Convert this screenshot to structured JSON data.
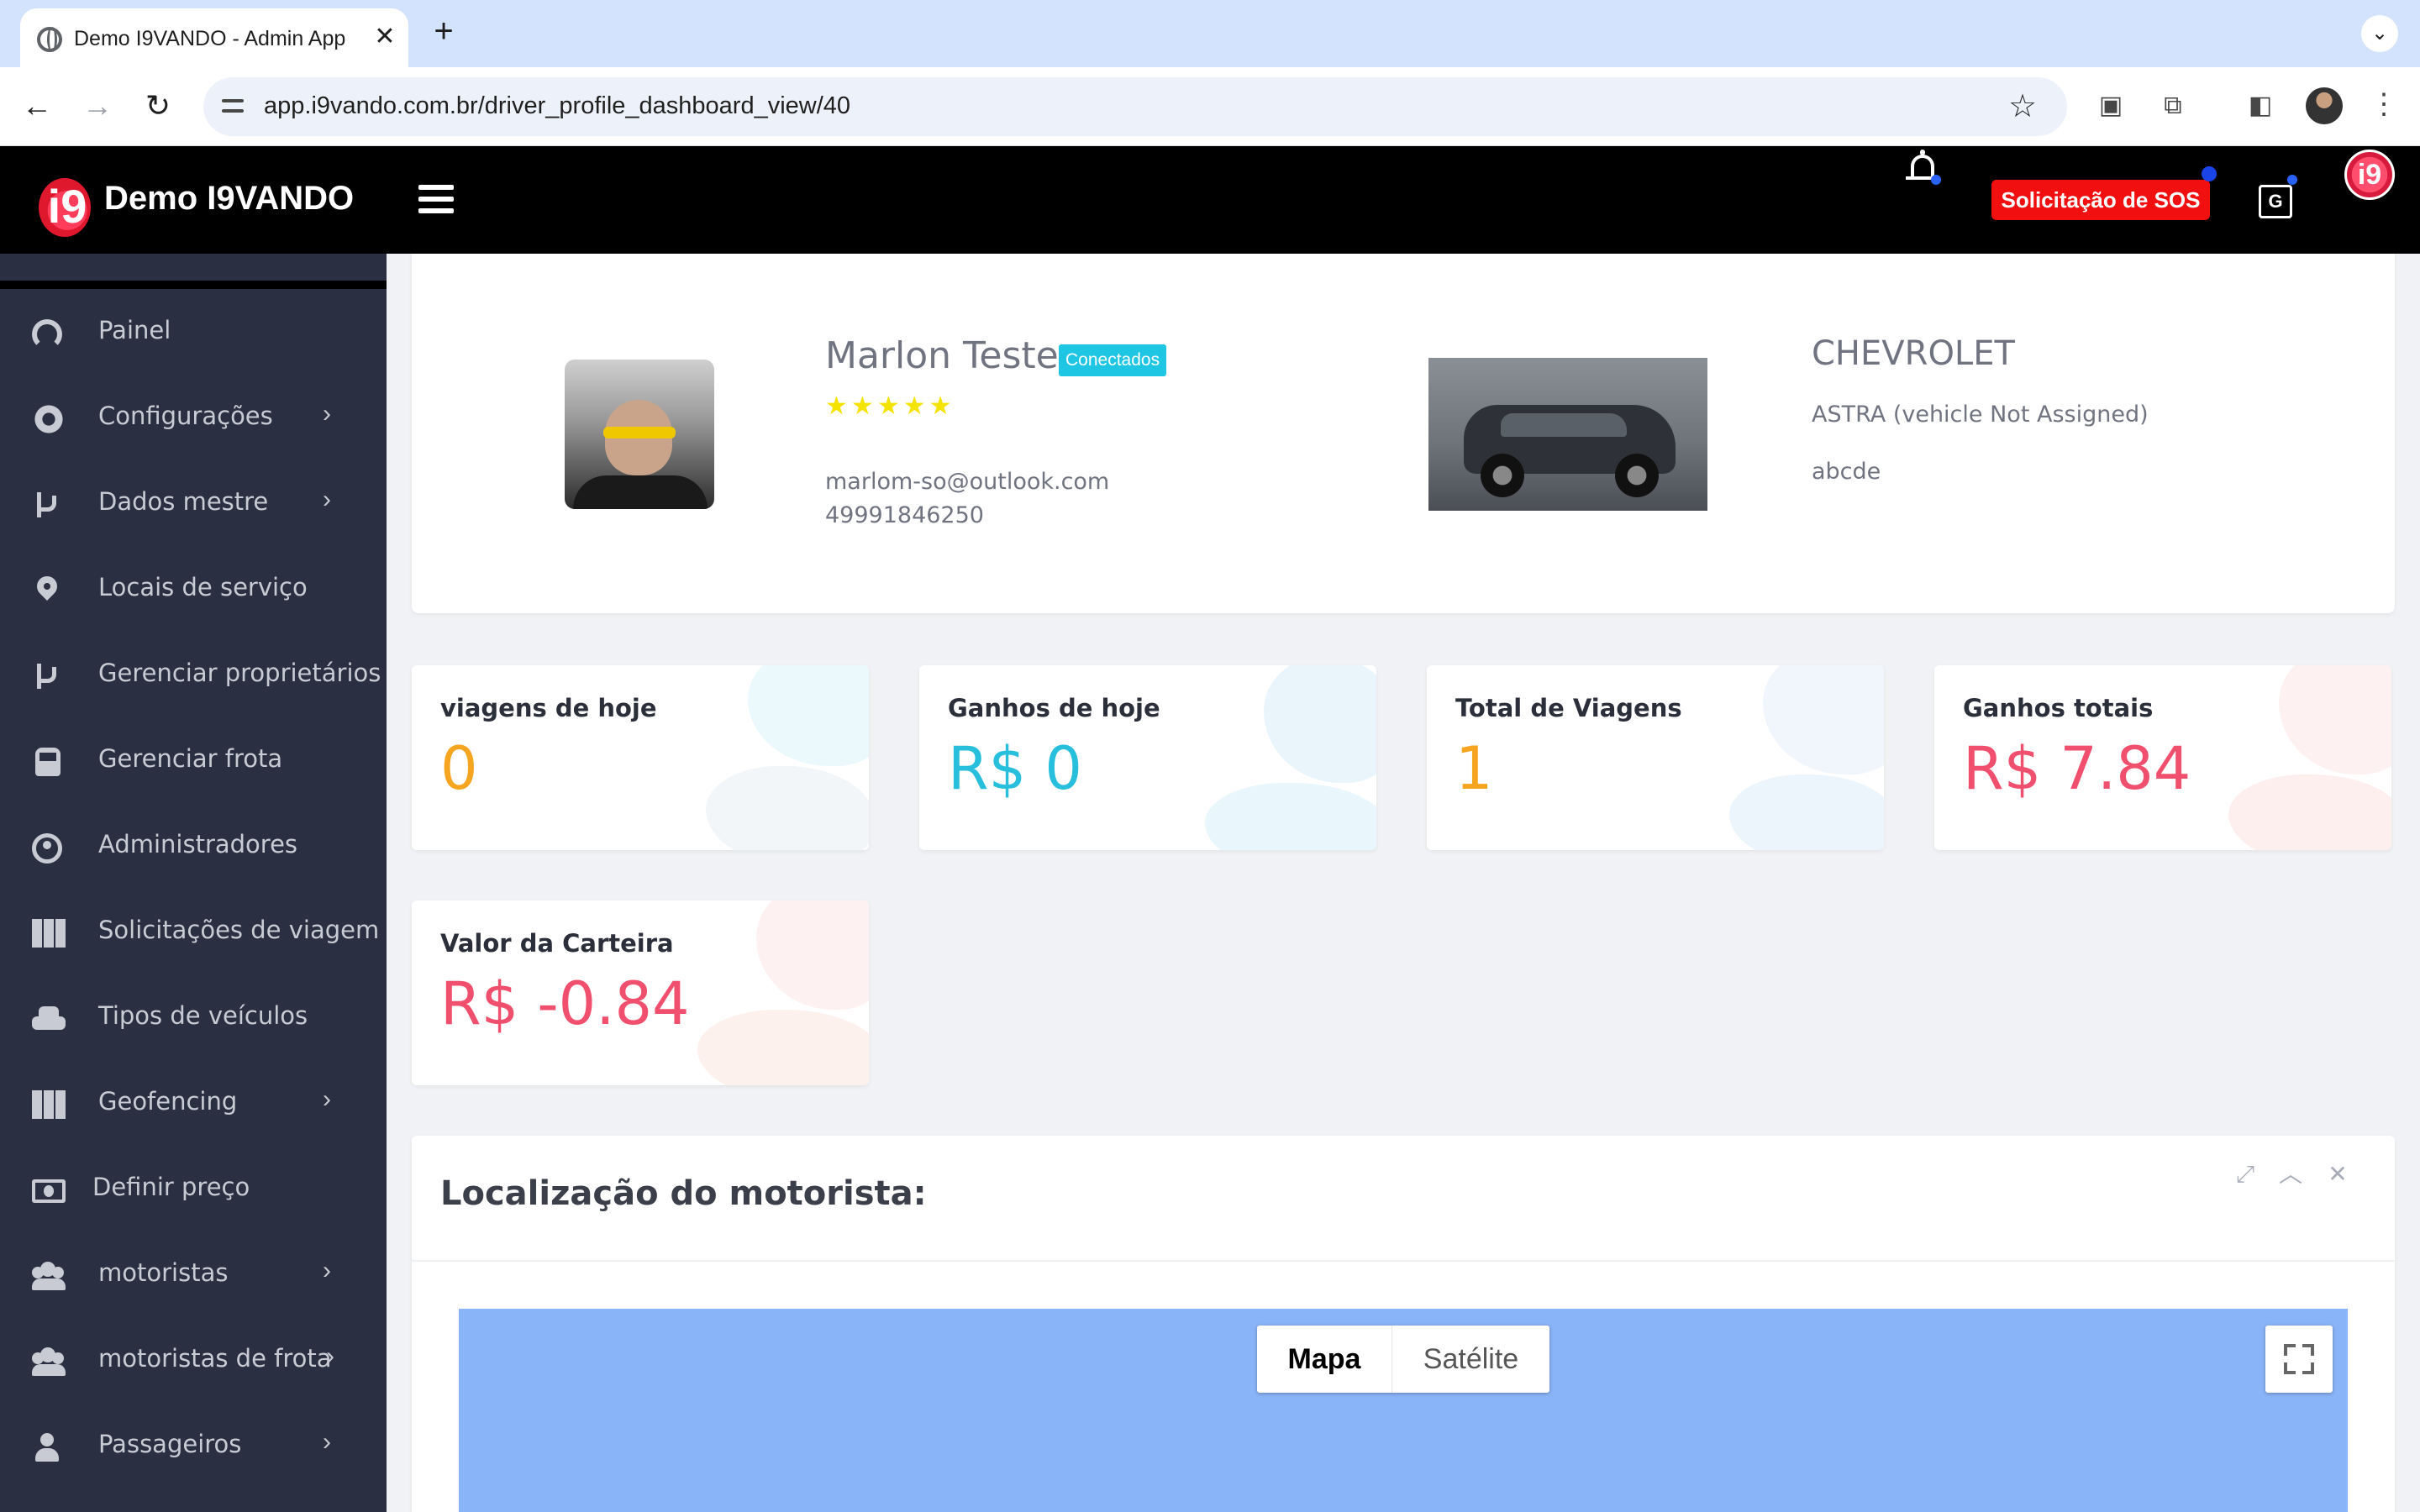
{
  "browser": {
    "tab_title": "Demo I9VANDO - Admin App",
    "tab_close": "✕",
    "new_tab": "+",
    "url": "app.i9vando.com.br/driver_profile_dashboard_view/40"
  },
  "header": {
    "brand": "Demo I9VANDO",
    "logo_glyph": "i9",
    "sos_label": "Solicitação de SOS",
    "avatar_glyph": "i9",
    "translate_glyph": "G"
  },
  "sidebar": {
    "items": [
      {
        "label": "Painel",
        "icon": "dashboard-icon",
        "submenu": false
      },
      {
        "label": "Configurações",
        "icon": "cogs-icon",
        "submenu": true
      },
      {
        "label": "Dados mestre",
        "icon": "code-branch-icon",
        "submenu": true
      },
      {
        "label": "Locais de serviço",
        "icon": "map-marker-icon",
        "submenu": false
      },
      {
        "label": "Gerenciar proprietários",
        "icon": "code-branch-icon",
        "submenu": false
      },
      {
        "label": "Gerenciar frota",
        "icon": "bus-icon",
        "submenu": false
      },
      {
        "label": "Administradores",
        "icon": "user-circle-icon",
        "submenu": false
      },
      {
        "label": "Solicitações de viagem",
        "icon": "map-icon",
        "submenu": false
      },
      {
        "label": "Tipos de veículos",
        "icon": "taxi-icon",
        "submenu": false
      },
      {
        "label": "Geofencing",
        "icon": "map-icon",
        "submenu": true
      },
      {
        "label": "Definir preço",
        "icon": "money-bill-icon",
        "submenu": false
      },
      {
        "label": "motoristas",
        "icon": "users-icon",
        "submenu": true
      },
      {
        "label": "motoristas de frota",
        "icon": "users-icon",
        "submenu": true
      },
      {
        "label": "Passageiros",
        "icon": "user-icon",
        "submenu": true
      }
    ],
    "chevron": "›"
  },
  "driver": {
    "name": "Marlon Teste",
    "status": "Conectados",
    "rating": 5,
    "star_glyph": "★",
    "email": "marlom-so@outlook.com",
    "phone": "49991846250"
  },
  "vehicle": {
    "make": "CHEVROLET",
    "model": "ASTRA (vehicle Not Assigned)",
    "plate": "abcde"
  },
  "stats": [
    {
      "label": "viagens de hoje",
      "value": "0",
      "color": "#f6a521"
    },
    {
      "label": "Ganhos de hoje",
      "value": "R$ 0",
      "color": "#27bfdc"
    },
    {
      "label": "Total de Viagens",
      "value": "1",
      "color": "#f6a521"
    },
    {
      "label": "Ganhos totais",
      "value": "R$ 7.84",
      "color": "#f0506e"
    },
    {
      "label": "Valor da Carteira",
      "value": "R$ -0.84",
      "color": "#f0506e"
    }
  ],
  "location": {
    "title": "Localização do motorista:",
    "map_type_map": "Mapa",
    "map_type_satellite": "Satélite"
  },
  "colors": {
    "sidebar_bg": "#2a3041",
    "header_bg": "#000000",
    "sos_red": "#f20f0f",
    "badge_cyan": "#1fc6e3",
    "map_blue": "#8ab4f8"
  }
}
